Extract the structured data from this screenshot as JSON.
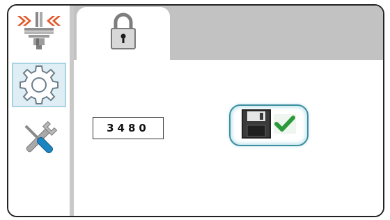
{
  "sidebar": {
    "items": [
      {
        "name": "sidebar-item-machine",
        "icon": "press-tool-icon"
      },
      {
        "name": "sidebar-item-settings",
        "icon": "gear-icon",
        "active": true
      },
      {
        "name": "sidebar-item-tools",
        "icon": "wrench-screwdriver-icon"
      }
    ]
  },
  "tabs": [
    {
      "icon": "padlock-icon",
      "active": true
    }
  ],
  "code": {
    "value": "3480"
  },
  "save_button": {
    "icons": [
      "floppy-disk-icon",
      "checkmark-icon"
    ]
  },
  "colors": {
    "accent_border": "#3d8fa0",
    "active_bg": "#dfeef4",
    "tabstrip": "#c2c2c2",
    "arrows": "#e2582b",
    "check": "#2c9a3a"
  }
}
